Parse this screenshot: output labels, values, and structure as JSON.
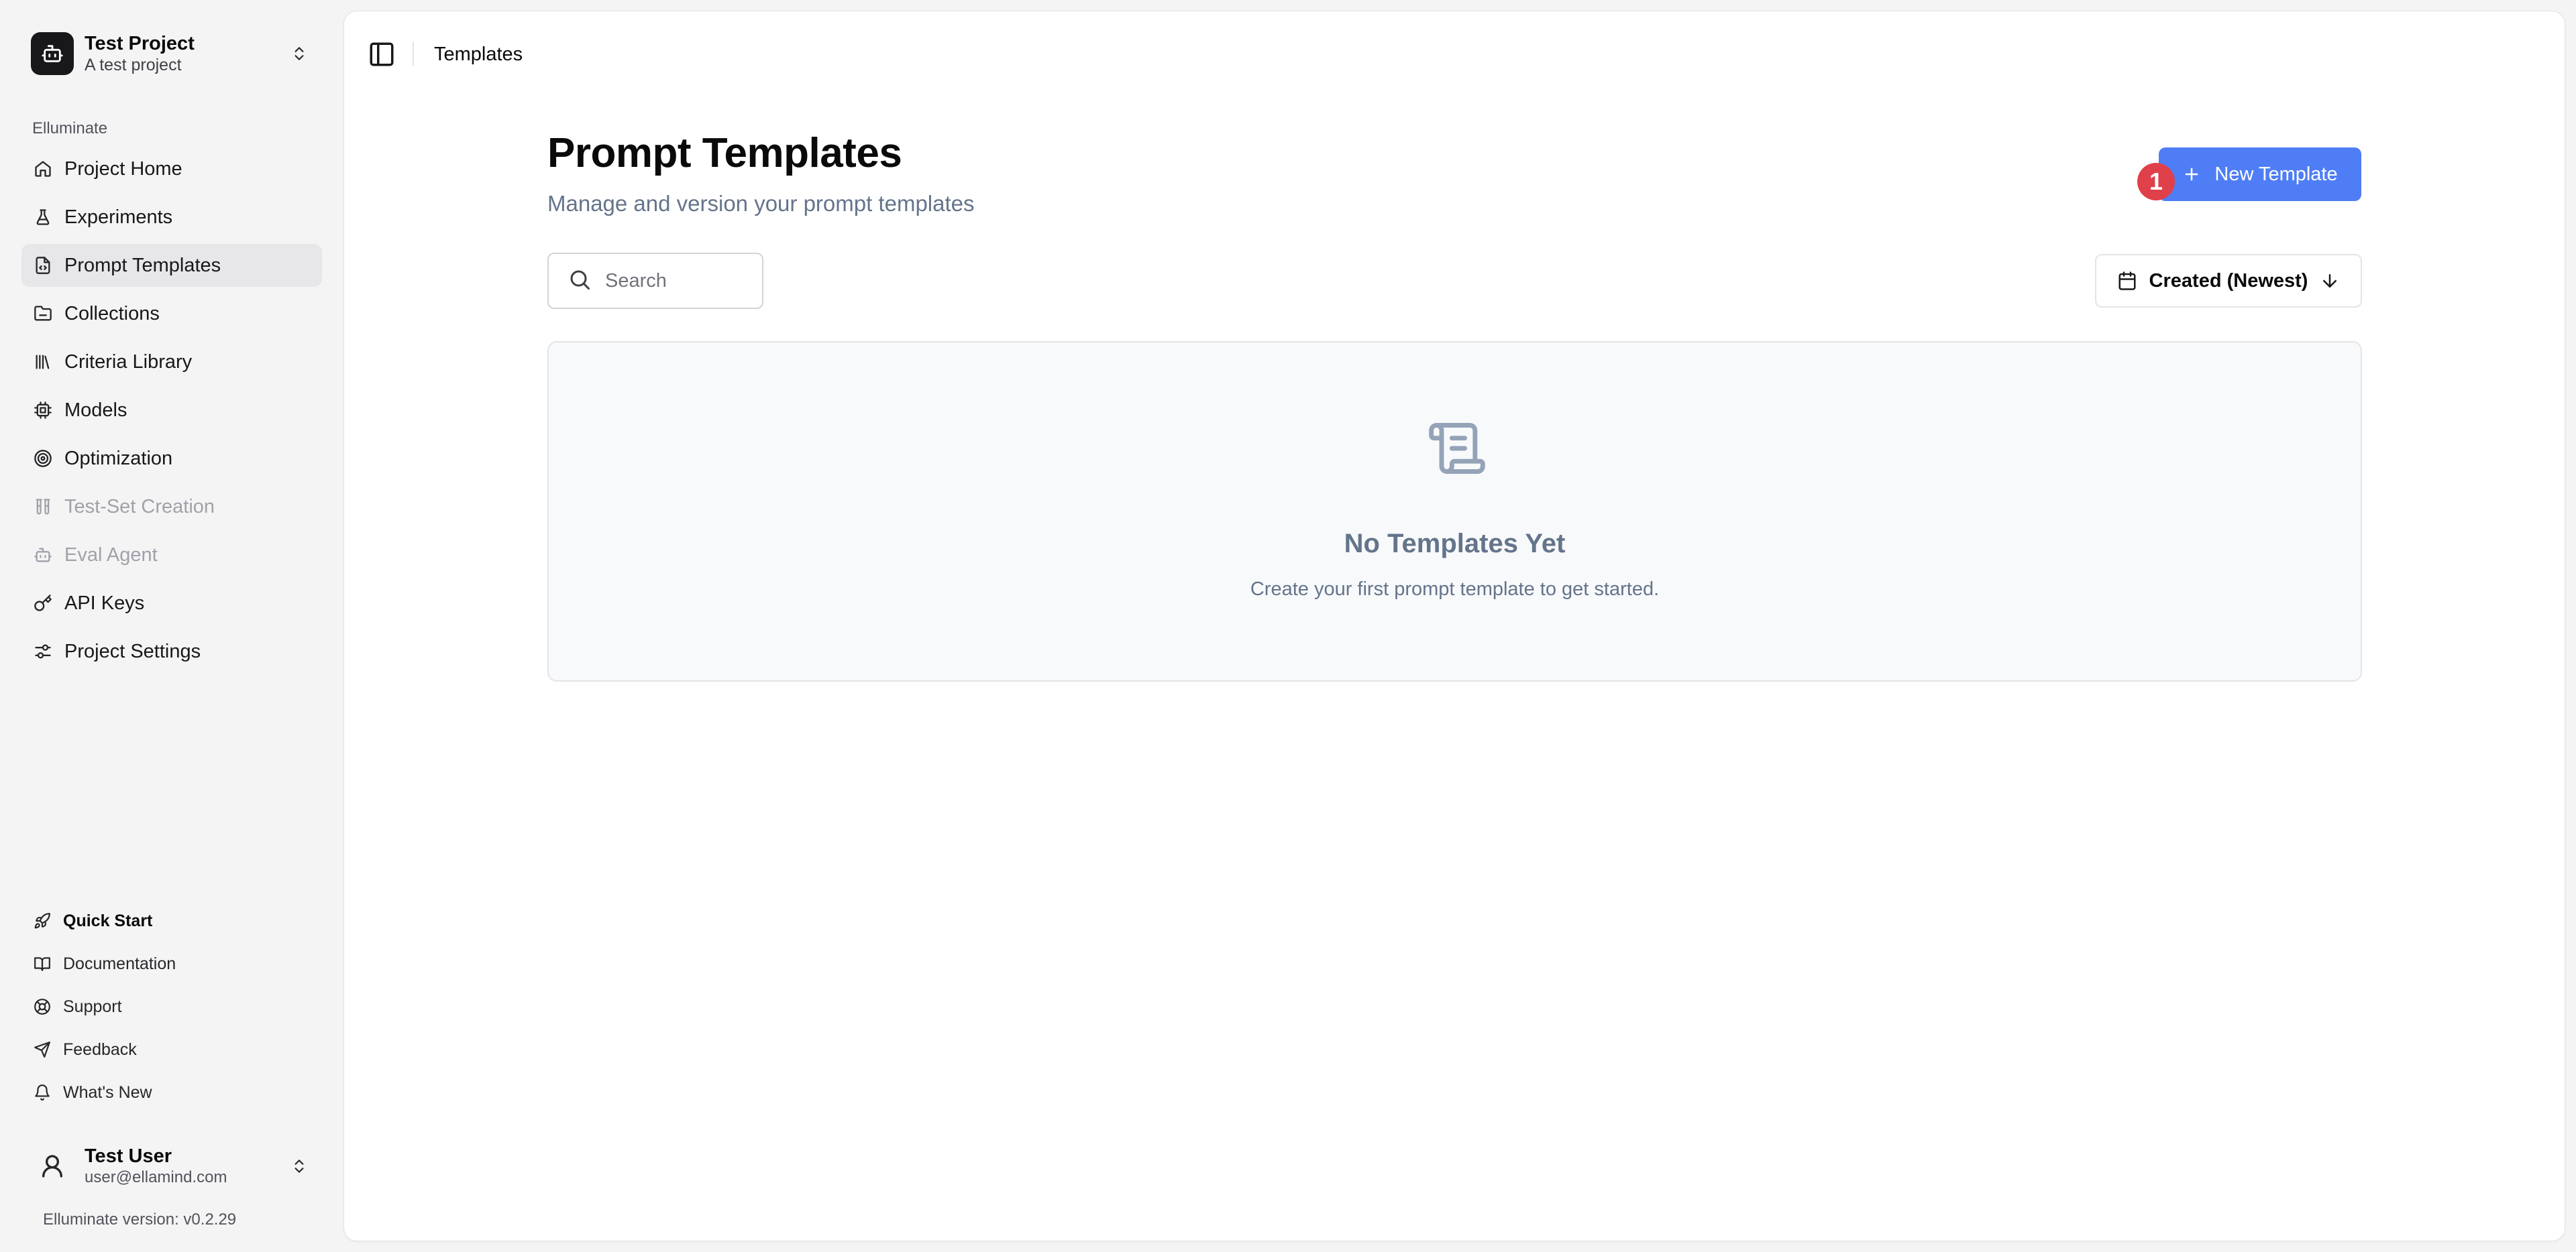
{
  "project": {
    "name": "Test Project",
    "description": "A test project"
  },
  "sidebar": {
    "group_label": "Elluminate",
    "items": [
      {
        "label": "Project Home",
        "icon": "home-icon"
      },
      {
        "label": "Experiments",
        "icon": "flask-icon"
      },
      {
        "label": "Prompt Templates",
        "icon": "file-code-icon",
        "active": true
      },
      {
        "label": "Collections",
        "icon": "folder-icon"
      },
      {
        "label": "Criteria Library",
        "icon": "library-icon"
      },
      {
        "label": "Models",
        "icon": "chip-icon"
      },
      {
        "label": "Optimization",
        "icon": "target-icon"
      },
      {
        "label": "Test-Set Creation",
        "icon": "test-tubes-icon",
        "disabled": true
      },
      {
        "label": "Eval Agent",
        "icon": "bot-icon",
        "disabled": true
      },
      {
        "label": "API Keys",
        "icon": "key-icon"
      },
      {
        "label": "Project Settings",
        "icon": "settings-icon"
      }
    ],
    "bottom_items": [
      {
        "label": "Quick Start",
        "icon": "rocket-icon",
        "bold": true
      },
      {
        "label": "Documentation",
        "icon": "book-icon"
      },
      {
        "label": "Support",
        "icon": "lifebuoy-icon"
      },
      {
        "label": "Feedback",
        "icon": "send-icon"
      },
      {
        "label": "What's New",
        "icon": "bell-icon"
      }
    ]
  },
  "user": {
    "name": "Test User",
    "email": "user@ellamind.com"
  },
  "version": "Elluminate version: v0.2.29",
  "topbar": {
    "breadcrumb": "Templates"
  },
  "page": {
    "title": "Prompt Templates",
    "subtitle": "Manage and version your prompt templates",
    "new_button": "New Template",
    "badge": "1",
    "search_placeholder": "Search",
    "sort_label": "Created (Newest)"
  },
  "empty_state": {
    "title": "No Templates Yet",
    "text": "Create your first prompt template to get started."
  },
  "colors": {
    "accent": "#4f7df5",
    "badge": "#e0404a",
    "muted_text": "#64748b"
  }
}
